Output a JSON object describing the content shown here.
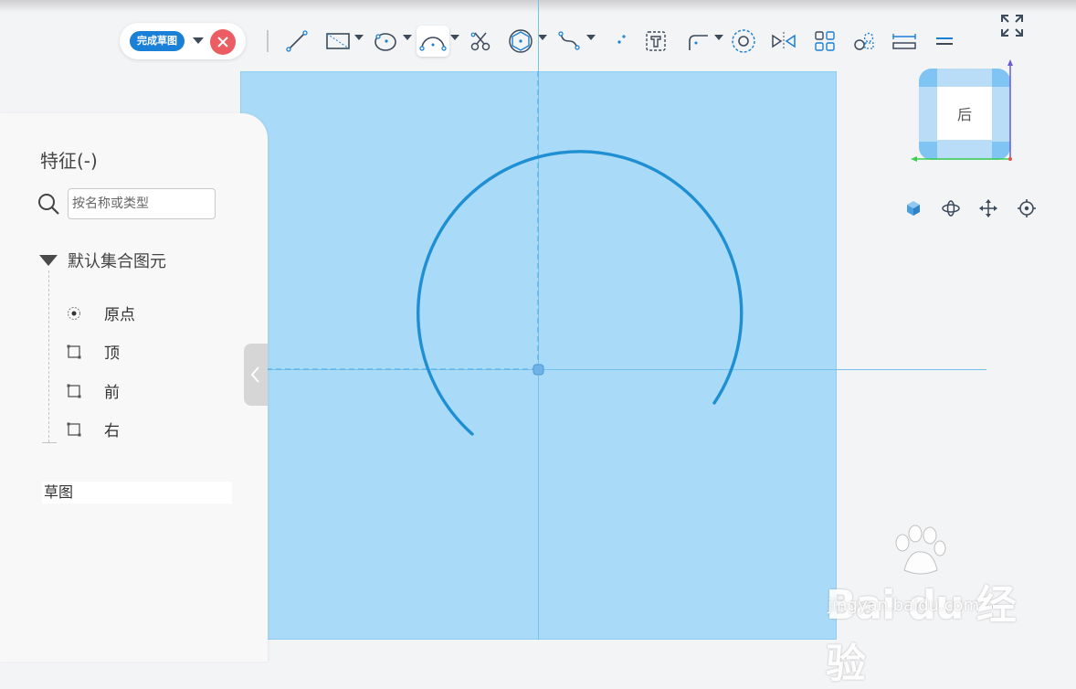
{
  "toolbar": {
    "finish_label": "完成草图"
  },
  "features": {
    "title": "特征(-)",
    "search_placeholder": "按名称或类型",
    "group_label": "默认集合图元",
    "items": [
      {
        "label": "原点",
        "icon": "origin-point-icon"
      },
      {
        "label": "顶",
        "icon": "plane-icon"
      },
      {
        "label": "前",
        "icon": "plane-icon"
      },
      {
        "label": "右",
        "icon": "plane-icon"
      }
    ],
    "sketch_label": "草图"
  },
  "view_cube": {
    "face_label": "后"
  },
  "watermark": {
    "brand": "Bai du 经验",
    "url": "jingyan.baidu.com"
  },
  "colors": {
    "accent": "#1a7fd6",
    "cancel": "#ec5d63",
    "sketch_plane": "#a9daf7",
    "arc": "#1f8fd3"
  }
}
